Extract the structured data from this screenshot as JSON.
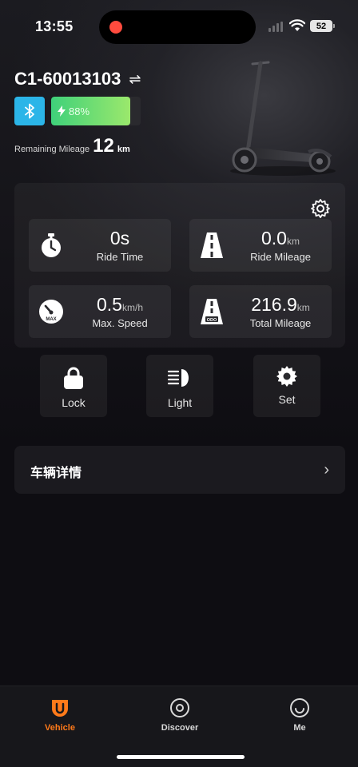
{
  "status_bar": {
    "time": "13:55",
    "battery": "52"
  },
  "header": {
    "device_id": "C1-60013103",
    "battery_percent_label": "88%",
    "battery_level": 0.88,
    "remaining_mileage_label": "Remaining Mileage",
    "remaining_mileage_value": "12",
    "remaining_mileage_unit": "km"
  },
  "stats": [
    {
      "value": "0s",
      "unit": "",
      "label": "Ride Time",
      "icon": "stopwatch-icon"
    },
    {
      "value": "0.0",
      "unit": "km",
      "label": "Ride Mileage",
      "icon": "road-icon"
    },
    {
      "value": "0.5",
      "unit": "km/h",
      "label": "Max. Speed",
      "icon": "speedometer-icon",
      "icon_text": "MAX"
    },
    {
      "value": "216.9",
      "unit": "km",
      "label": "Total Mileage",
      "icon": "road-odometer-icon",
      "icon_text": "ODO"
    }
  ],
  "quick_actions": [
    {
      "label": "Lock",
      "icon": "lock-icon"
    },
    {
      "label": "Light",
      "icon": "headlight-icon"
    },
    {
      "label": "Set",
      "icon": "gear-icon"
    }
  ],
  "details": {
    "label": "车辆详情"
  },
  "tabs": [
    {
      "label": "Vehicle",
      "icon": "vehicle-icon",
      "active": true
    },
    {
      "label": "Discover",
      "icon": "discover-icon",
      "active": false
    },
    {
      "label": "Me",
      "icon": "smile-icon",
      "active": false
    }
  ],
  "colors": {
    "accent": "#ff7a1a",
    "bluetooth": "#2bb5e8",
    "battery_green": "#5fd877"
  }
}
